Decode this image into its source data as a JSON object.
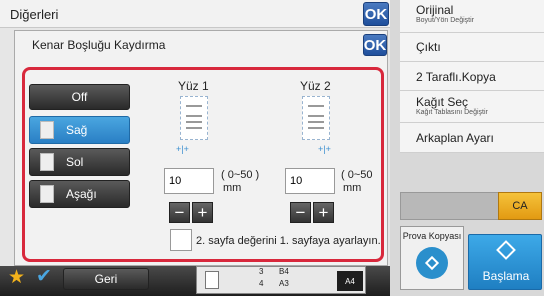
{
  "outer_title": "Diğerleri",
  "outer_ok": "OK",
  "dialog": {
    "title": "Kenar Boşluğu Kaydırma",
    "ok": "OK",
    "options": [
      {
        "label": "Off"
      },
      {
        "label": "Sağ"
      },
      {
        "label": "Sol"
      },
      {
        "label": "Aşağı"
      }
    ],
    "side1": {
      "label": "Yüz 1",
      "value": "10",
      "range": "( 0~50 )",
      "unit": "mm"
    },
    "side2": {
      "label": "Yüz 2",
      "value": "10",
      "range": "( 0~50",
      "unit": "mm"
    },
    "minus": "−",
    "plus": "+",
    "checkbox_label": "2. sayfa değerini 1. sayfaya ayarlayın."
  },
  "right_panel": [
    {
      "main": "Orijinal",
      "sub": "Boyut/Yön Değiştir"
    },
    {
      "main": "Çıktı",
      "sub": ""
    },
    {
      "main": "2 Taraflı.Kopya",
      "sub": ""
    },
    {
      "main": "Kağıt Seç",
      "sub": "Kağıt Tablasını Değiştir"
    },
    {
      "main": "Arkaplan Ayarı",
      "sub": ""
    }
  ],
  "ca_label": "CA",
  "proof_label": "Prova Kopyası",
  "start_label": "Başlama",
  "back_label": "Geri",
  "tray_info": {
    "row1_num": "3",
    "row1_size": "B4",
    "row2_num": "4",
    "row2_size": "A3",
    "paper": "A4"
  },
  "colors": {
    "accent": "#2a7fc4",
    "highlight_border": "#d8283c",
    "ok": "#1f4f9c"
  }
}
